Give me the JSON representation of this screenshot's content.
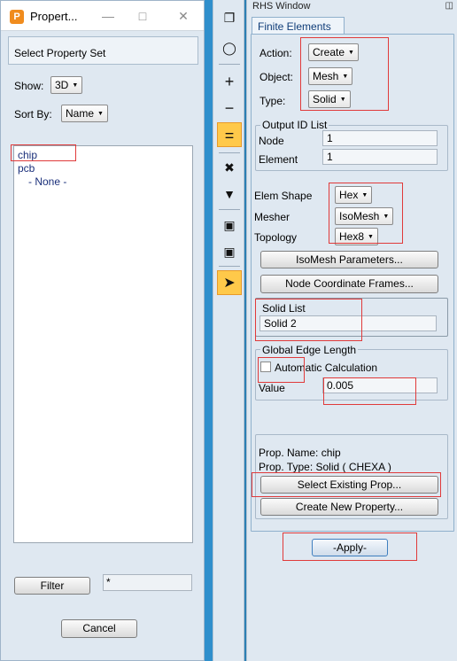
{
  "left_dialog": {
    "title": "Propert...",
    "header": "Select Property Set",
    "show_label": "Show:",
    "show_value": "3D",
    "sort_label": "Sort By:",
    "sort_value": "Name",
    "items": [
      {
        "label": "chip"
      },
      {
        "label": "pcb"
      },
      {
        "label": "- None -"
      }
    ],
    "filter_label": "Filter",
    "filter_value": "*",
    "cancel_label": "Cancel"
  },
  "toolbar": {
    "icons": [
      "copy-icon",
      "lasso-icon",
      "plus-icon",
      "minus-icon",
      "equals-icon",
      "cross-tools-icon",
      "filter-icon",
      "move-up-icon",
      "move-down-icon",
      "cursor-icon"
    ]
  },
  "rhs": {
    "title": "RHS Window",
    "tab": "Finite Elements",
    "action_label": "Action:",
    "action_value": "Create",
    "object_label": "Object:",
    "object_value": "Mesh",
    "type_label": "Type:",
    "type_value": "Solid",
    "output_group": "Output ID List",
    "node_label": "Node",
    "node_value": "1",
    "element_label": "Element",
    "element_value": "1",
    "elem_shape_label": "Elem Shape",
    "elem_shape_value": "Hex",
    "mesher_label": "Mesher",
    "mesher_value": "IsoMesh",
    "topology_label": "Topology",
    "topology_value": "Hex8",
    "isomesh_btn": "IsoMesh Parameters...",
    "node_frames_btn": "Node Coordinate Frames...",
    "solid_list_label": "Solid List",
    "solid_list_value": "Solid 2",
    "edge_group": "Global Edge Length",
    "auto_calc_label": "Automatic Calculation",
    "value_label": "Value",
    "value_value": "0.005",
    "prop_name": "Prop. Name: chip",
    "prop_type": "Prop. Type: Solid ( CHEXA )",
    "select_prop_btn": "Select Existing Prop...",
    "create_prop_btn": "Create New Property...",
    "apply_btn": "-Apply-"
  },
  "colors": {
    "highlight": "#e03a3a",
    "active_tool": "#ffc94a",
    "accent": "#0e3c78"
  }
}
